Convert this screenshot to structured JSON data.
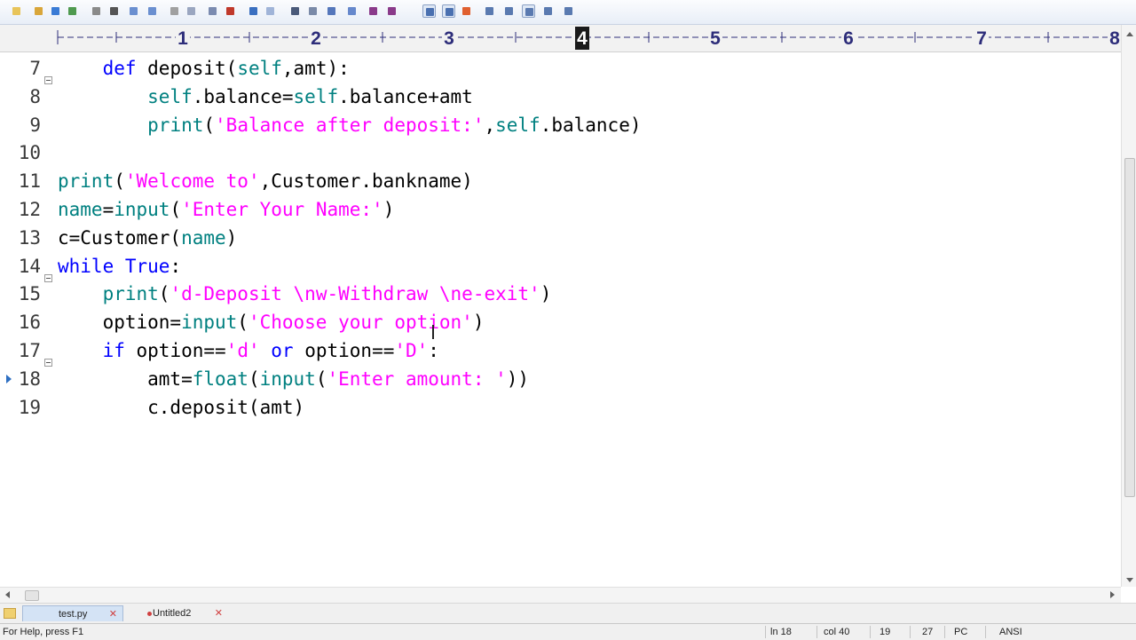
{
  "ruler": {
    "numbers": [
      "1",
      "2",
      "3",
      "4",
      "5",
      "6",
      "7",
      "8"
    ],
    "highlight": "4"
  },
  "lines": [
    {
      "num": "7",
      "fold": true,
      "tokens": [
        [
          "id",
          "    "
        ],
        [
          "kw",
          "def"
        ],
        [
          "id",
          " deposit("
        ],
        [
          "bi",
          "self"
        ],
        [
          "id",
          ",amt):"
        ]
      ]
    },
    {
      "num": "8",
      "tokens": [
        [
          "id",
          "        "
        ],
        [
          "bi",
          "self"
        ],
        [
          "id",
          ".balance="
        ],
        [
          "bi",
          "self"
        ],
        [
          "id",
          ".balance+amt"
        ]
      ]
    },
    {
      "num": "9",
      "tokens": [
        [
          "id",
          "        "
        ],
        [
          "bi",
          "print"
        ],
        [
          "id",
          "("
        ],
        [
          "str",
          "'Balance after deposit:'"
        ],
        [
          "id",
          ","
        ],
        [
          "bi",
          "self"
        ],
        [
          "id",
          ".balance)"
        ]
      ]
    },
    {
      "num": "10",
      "tokens": []
    },
    {
      "num": "11",
      "tokens": [
        [
          "bi",
          "print"
        ],
        [
          "id",
          "("
        ],
        [
          "str",
          "'Welcome to'"
        ],
        [
          "id",
          ",Customer.bankname)"
        ]
      ]
    },
    {
      "num": "12",
      "tokens": [
        [
          "bi",
          "name"
        ],
        [
          "id",
          "="
        ],
        [
          "bi",
          "input"
        ],
        [
          "id",
          "("
        ],
        [
          "str",
          "'Enter Your Name:'"
        ],
        [
          "id",
          ")"
        ]
      ]
    },
    {
      "num": "13",
      "tokens": [
        [
          "id",
          "c=Customer("
        ],
        [
          "bi",
          "name"
        ],
        [
          "id",
          ")"
        ]
      ]
    },
    {
      "num": "14",
      "fold": true,
      "tokens": [
        [
          "kw",
          "while"
        ],
        [
          "id",
          " "
        ],
        [
          "kw",
          "True"
        ],
        [
          "id",
          ":"
        ]
      ]
    },
    {
      "num": "15",
      "tokens": [
        [
          "id",
          "    "
        ],
        [
          "bi",
          "print"
        ],
        [
          "id",
          "("
        ],
        [
          "str",
          "'d-Deposit \\nw-Withdraw \\ne-exit'"
        ],
        [
          "id",
          ")"
        ]
      ]
    },
    {
      "num": "16",
      "tokens": [
        [
          "id",
          "    option="
        ],
        [
          "bi",
          "input"
        ],
        [
          "id",
          "("
        ],
        [
          "str",
          "'Choose your option'"
        ],
        [
          "id",
          ")"
        ]
      ]
    },
    {
      "num": "17",
      "fold": true,
      "tokens": [
        [
          "id",
          "    "
        ],
        [
          "kw",
          "if"
        ],
        [
          "id",
          " option=="
        ],
        [
          "str",
          "'d'"
        ],
        [
          "id",
          " "
        ],
        [
          "kw",
          "or"
        ],
        [
          "id",
          " option=="
        ],
        [
          "str",
          "'D'"
        ],
        [
          "id",
          ":"
        ]
      ]
    },
    {
      "num": "18",
      "bookmark": true,
      "tokens": [
        [
          "id",
          "        amt="
        ],
        [
          "bi",
          "float"
        ],
        [
          "id",
          "("
        ],
        [
          "bi",
          "input"
        ],
        [
          "id",
          "("
        ],
        [
          "str",
          "'Enter amount: '"
        ],
        [
          "id",
          "))"
        ]
      ]
    },
    {
      "num": "19",
      "tokens": [
        [
          "id",
          "        c.deposit(amt)"
        ]
      ]
    }
  ],
  "tabs": [
    {
      "label": "test.py",
      "active": true
    },
    {
      "label": "Untitled2",
      "active": false
    }
  ],
  "status": {
    "help": "For Help, press F1",
    "line": "ln 18",
    "col": "col 40",
    "val1": "19",
    "val2": "27",
    "eol": "PC",
    "encoding": "ANSI"
  },
  "colors": {
    "keyword": "#0000ff",
    "builtin": "#008080",
    "string": "#ff00ff",
    "text": "#000000"
  },
  "icons": [
    "new-file-icon",
    "open-folder-icon",
    "save-icon",
    "save-all-icon",
    "print-preview-icon",
    "print-icon",
    "spellcheck-icon",
    "html-icon",
    "cut-icon",
    "copy-icon",
    "paste-icon",
    "delete-icon",
    "undo-icon",
    "redo-icon",
    "find-icon",
    "find-replace-icon",
    "find-in-files-icon",
    "indent-icon",
    "hex-icon",
    "bold-hx-icon",
    "word-wrap-icon",
    "ruler-icon",
    "spell-check-mark-icon",
    "window-icon",
    "tile-icon",
    "full-screen-icon",
    "cascade-icon",
    "context-help-icon"
  ]
}
